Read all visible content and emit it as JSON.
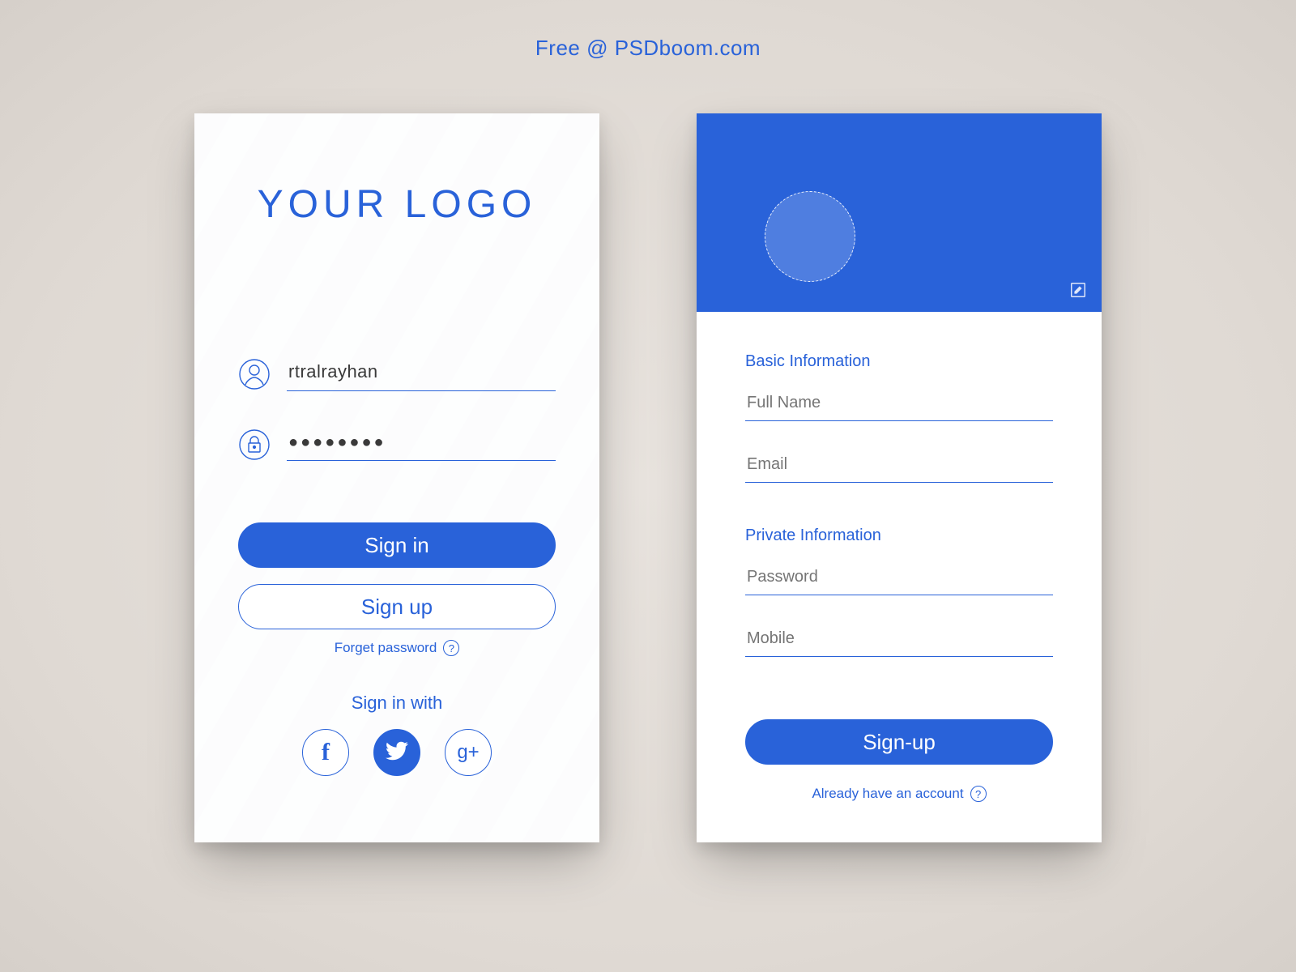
{
  "attribution": "Free @ PSDboom.com",
  "login": {
    "logo_text": "YOUR LOGO",
    "username_value": "rtralrayhan",
    "password_mask": "●●●●●●●●",
    "signin_label": "Sign in",
    "signup_label": "Sign up",
    "forgot_label": "Forget password",
    "help_glyph": "?",
    "signin_with_label": "Sign in with",
    "social": {
      "facebook": "f",
      "twitter": "twitter",
      "google": "g+"
    }
  },
  "signup": {
    "basic_section_title": "Basic Information",
    "fullname_placeholder": "Full Name",
    "email_placeholder": "Email",
    "private_section_title": "Private Information",
    "password_placeholder": "Password",
    "mobile_placeholder": "Mobile",
    "submit_label": "Sign-up",
    "already_label": "Already have an account",
    "help_glyph": "?"
  },
  "colors": {
    "accent": "#2962d9"
  }
}
